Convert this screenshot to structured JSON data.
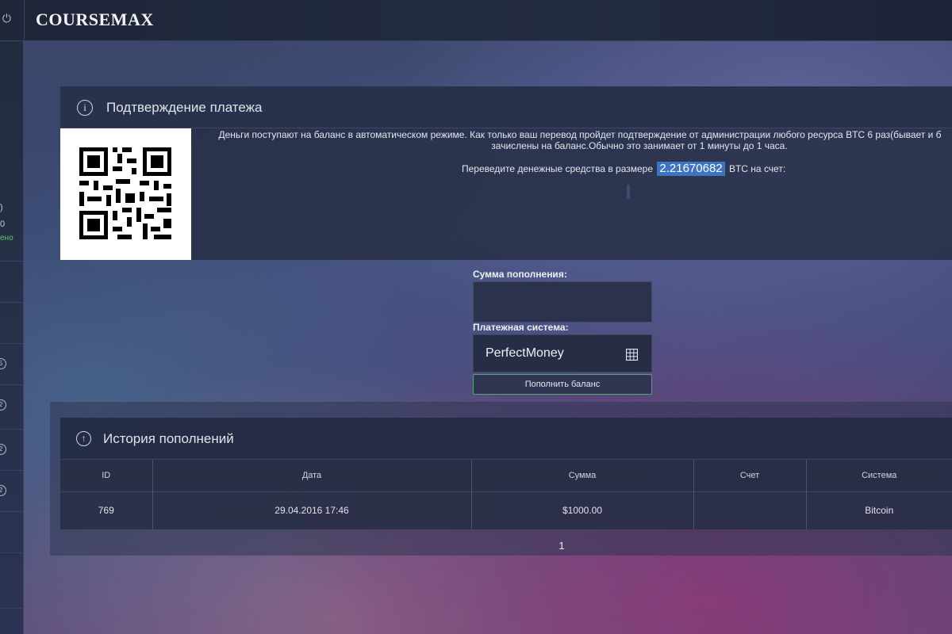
{
  "brand": "COURSEMAX",
  "sidebar": {
    "partial_texts": [
      ")",
      "0",
      "ено"
    ],
    "badges": [
      "5",
      "2",
      "2",
      "2"
    ]
  },
  "confirm": {
    "title": "Подтверждение платежа",
    "text_line1": "Деньги поступают на баланс в автоматическом режиме. Как только ваш перевод пройдет подтверждение от администрации любого ресурса BTC 6 раз(бывает и б",
    "text_line2": "зачислены на баланс.Обычно это занимает от 1 минуты до 1 часа.",
    "amount_prefix": "Переведите денежные средства в размере",
    "amount_value": "2.21670682",
    "amount_suffix": "BTC на счет:"
  },
  "form": {
    "amount_label": "Сумма пополнения:",
    "amount_value": "",
    "system_label": "Платежная система:",
    "system_value": "PerfectMoney",
    "submit_label": "Пополнить баланс"
  },
  "history": {
    "title": "История пополнений",
    "columns": [
      "ID",
      "Дата",
      "Сумма",
      "Счет",
      "Система"
    ],
    "rows": [
      [
        "769",
        "29.04.2016 17:46",
        "$1000.00",
        "",
        "Bitcoin"
      ]
    ],
    "page": "1"
  },
  "icons": {
    "power": "power-icon",
    "info": "info-icon",
    "grid": "grid-icon",
    "up": "arrow-up-circle-icon",
    "qr": "qr-code-icon"
  }
}
